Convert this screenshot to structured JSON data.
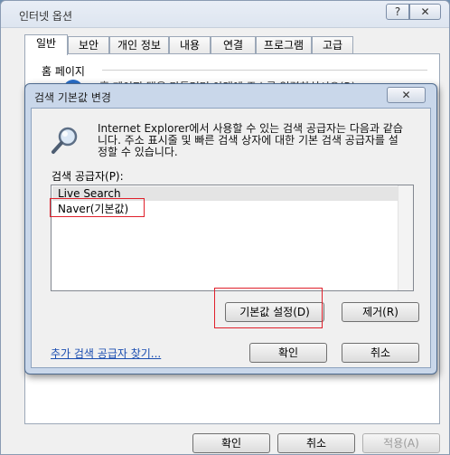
{
  "window": {
    "title": "인터넷 옵션",
    "help_button": "?",
    "close_button": "✕",
    "tabs": [
      {
        "label": "일반",
        "active": true
      },
      {
        "label": "보안",
        "active": false
      },
      {
        "label": "개인 정보",
        "active": false
      },
      {
        "label": "내용",
        "active": false
      },
      {
        "label": "연결",
        "active": false
      },
      {
        "label": "프로그램",
        "active": false
      },
      {
        "label": "고급",
        "active": false
      }
    ],
    "home_page": {
      "section_label": "홈 페이지",
      "instruction": "홈 페이지 탭을 만들려면 아래에 주소를 입력하십시오(R)."
    },
    "buttons": {
      "ok": "확인",
      "cancel": "취소",
      "apply": "적용(A)"
    }
  },
  "dialog": {
    "title": "검색 기본값 변경",
    "close_button": "✕",
    "description": "Internet Explorer에서 사용할 수 있는 검색 공급자는 다음과 같습니다. 주소 표시줄 및 빠른 검색 상자에 대한 기본 검색 공급자를 설정할 수 있습니다.",
    "providers_label": "검색 공급자(P):",
    "providers": [
      {
        "name": "Live Search",
        "selected": true
      },
      {
        "name": "Naver(기본값)",
        "selected": false
      }
    ],
    "set_default_button": "기본값 설정(D)",
    "remove_button": "제거(R)",
    "find_more_link": "추가 검색 공급자 찾기...",
    "ok_button": "확인",
    "cancel_button": "취소"
  },
  "colors": {
    "annotation_red": "#e0202b",
    "link_blue": "#1a4db0",
    "dialog_frame": "#c9d7ea"
  }
}
